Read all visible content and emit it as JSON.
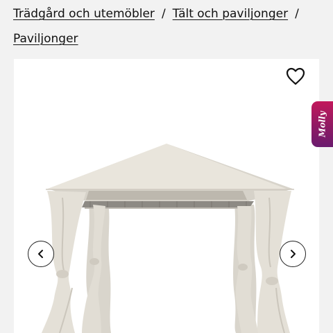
{
  "breadcrumb": {
    "items": [
      {
        "label": "Trädgård och utemöbler"
      },
      {
        "label": "Tält och paviljonger"
      },
      {
        "label": "Paviljonger"
      }
    ],
    "separator": "/"
  },
  "product": {
    "favorite_icon": "heart-outline-icon",
    "image": "gazebo-with-beige-curtains",
    "prev_icon": "chevron-left-icon",
    "next_icon": "chevron-right-icon"
  },
  "chat_widget": {
    "label": "Molly"
  },
  "colors": {
    "background": "#f2f2f2",
    "card": "#ffffff",
    "text": "#111111",
    "canopy": "#e9e5dc",
    "chat_widget": "#a3185f"
  }
}
